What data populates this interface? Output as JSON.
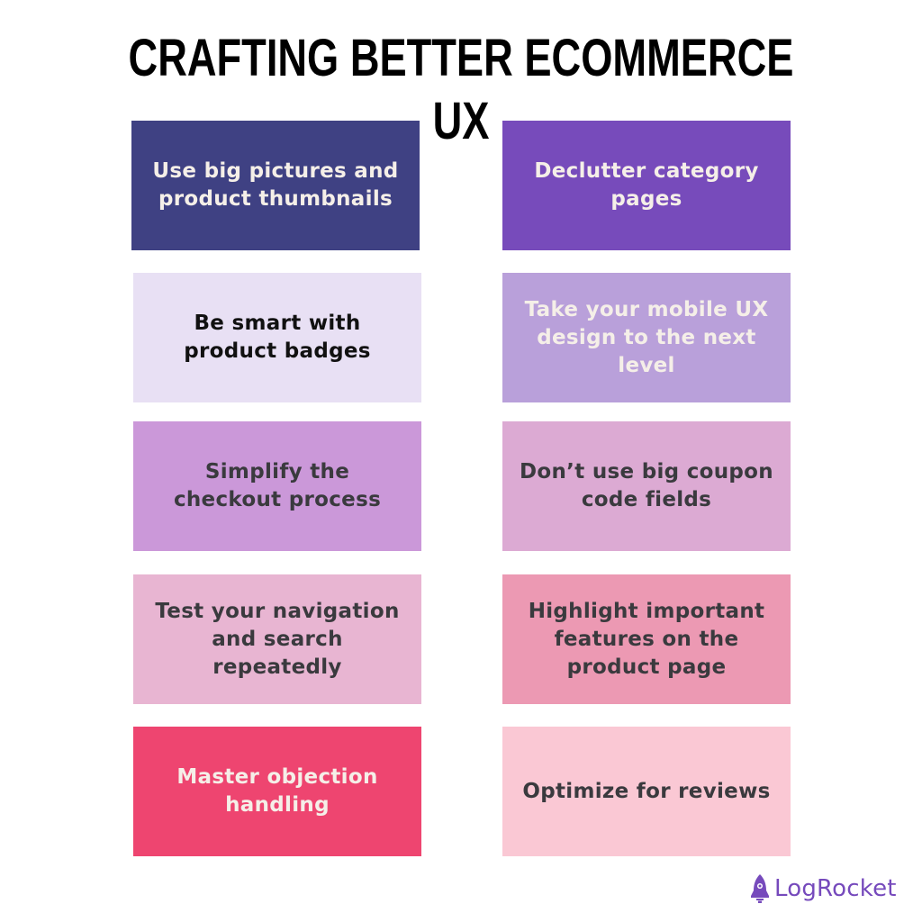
{
  "title": "CRAFTING BETTER ECOMMERCE UX",
  "cards": [
    {
      "text": "Use big pictures and product thumbnails",
      "bg": "#3f4183",
      "fg": "#f5efe8"
    },
    {
      "text": "Declutter category pages",
      "bg": "#774bbb",
      "fg": "#f5efe8"
    },
    {
      "text": "Be smart with product badges",
      "bg": "#e8e0f4",
      "fg": "#111111"
    },
    {
      "text": "Take your mobile UX design to the next level",
      "bg": "#b9a0da",
      "fg": "#f5efe8"
    },
    {
      "text": "Simplify the checkout process",
      "bg": "#cb98d9",
      "fg": "#3a3a3e"
    },
    {
      "text": "Don’t use big coupon code fields",
      "bg": "#dcaad3",
      "fg": "#3a3a3e"
    },
    {
      "text": "Test your navigation and search repeatedly",
      "bg": "#e8b5d2",
      "fg": "#3a3a3e"
    },
    {
      "text": "Highlight important features on the product page",
      "bg": "#ec99b3",
      "fg": "#3a3a3e"
    },
    {
      "text": "Master objection handling",
      "bg": "#ee4570",
      "fg": "#f5efe8"
    },
    {
      "text": "Optimize for reviews",
      "bg": "#fac8d4",
      "fg": "#3a3a3e"
    }
  ],
  "brand": {
    "name": "LogRocket",
    "icon": "rocket-icon",
    "color": "#764abc"
  }
}
